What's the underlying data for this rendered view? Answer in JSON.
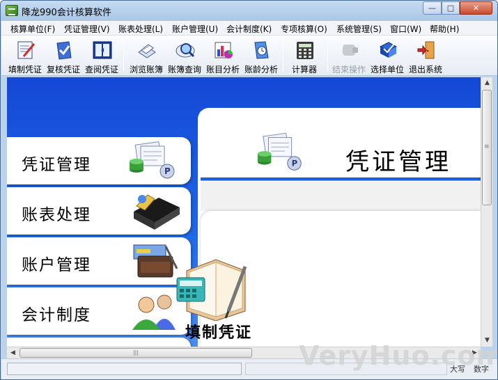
{
  "window": {
    "title": "降龙990会计核算软件",
    "min": "—",
    "max": "□",
    "close": "✕"
  },
  "menu": [
    "核算单位(F)",
    "凭证管理(V)",
    "账表处理(L)",
    "账户管理(U)",
    "会计制度(K)",
    "专项核算(O)",
    "系统管理(S)",
    "窗口(W)",
    "帮助(H)"
  ],
  "toolbar": [
    {
      "label": "填制凭证",
      "icon": "voucher-edit-icon",
      "enabled": true
    },
    {
      "label": "复核凭证",
      "icon": "voucher-check-icon",
      "enabled": true
    },
    {
      "label": "查阅凭证",
      "icon": "voucher-view-icon",
      "enabled": true
    },
    {
      "label": "浏览账簿",
      "icon": "ledger-browse-icon",
      "enabled": true
    },
    {
      "label": "账簿查询",
      "icon": "ledger-search-icon",
      "enabled": true
    },
    {
      "label": "账目分析",
      "icon": "chart-analysis-icon",
      "enabled": true
    },
    {
      "label": "账龄分析",
      "icon": "clock-analysis-icon",
      "enabled": true
    },
    {
      "label": "计算器",
      "icon": "calculator-icon",
      "enabled": true
    },
    {
      "label": "结束操作",
      "icon": "end-operation-icon",
      "enabled": false
    },
    {
      "label": "选择单位",
      "icon": "select-unit-icon",
      "enabled": true
    },
    {
      "label": "退出系统",
      "icon": "exit-icon",
      "enabled": true
    }
  ],
  "left_panel": [
    {
      "label": "凭证管理",
      "icon": "voucher-stack-icon"
    },
    {
      "label": "账表处理",
      "icon": "ledger-book-icon"
    },
    {
      "label": "账户管理",
      "icon": "account-wallet-icon"
    },
    {
      "label": "会计制度",
      "icon": "people-icon"
    }
  ],
  "right_panel": {
    "title": "凭证管理",
    "card_label": "填制凭证",
    "card_icon": "notebook-calculator-icon"
  },
  "scrollbar": {
    "h_grip": "|||",
    "v_grip": "≡"
  },
  "status": {
    "big": "大写",
    "num": "数字"
  },
  "watermark": "VeryHuo.com",
  "colors": {
    "accent_blue": "#1448d6",
    "rule_blue": "#1c5fd6"
  }
}
